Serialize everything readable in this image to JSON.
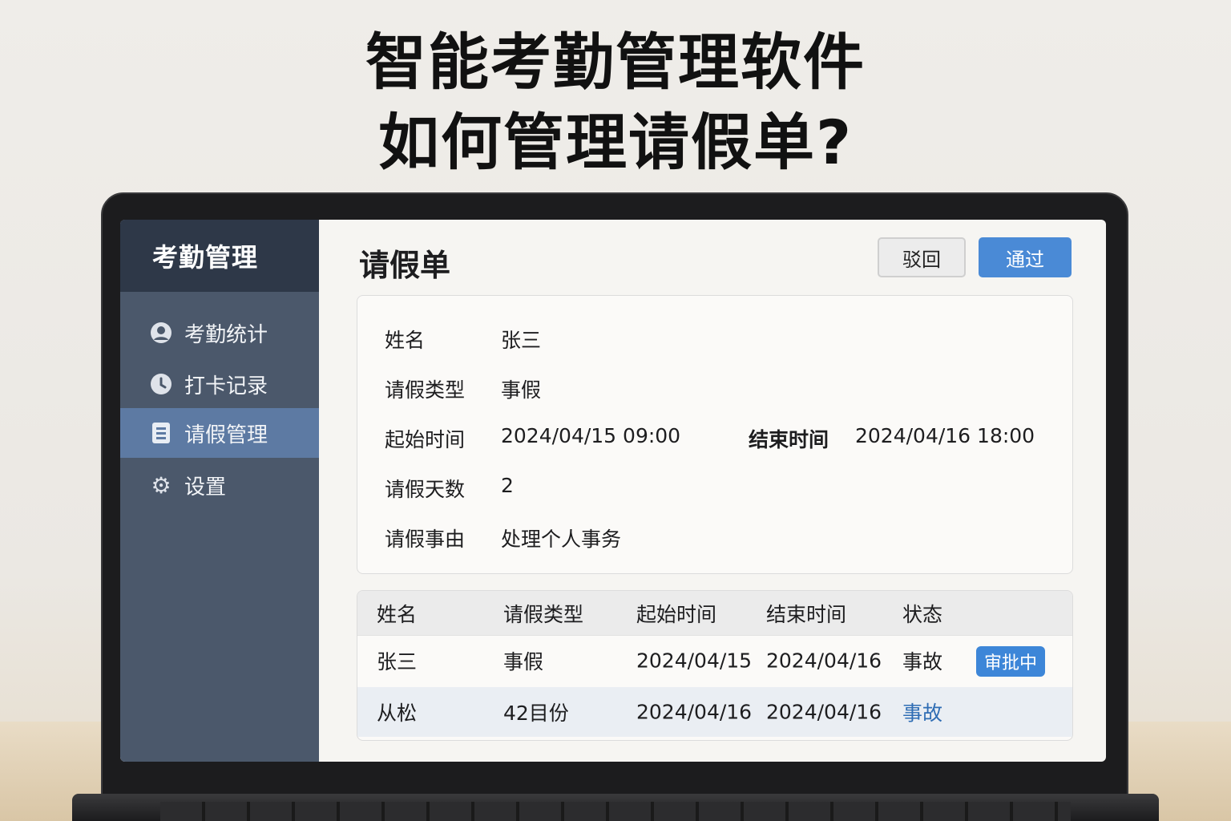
{
  "headline": {
    "line1": "智能考勤管理软件",
    "line2": "如何管理请假单?"
  },
  "sidebar": {
    "title": "考勤管理",
    "items": [
      {
        "label": "考勤统计",
        "icon": "user-icon"
      },
      {
        "label": "打卡记录",
        "icon": "clock-icon"
      },
      {
        "label": "请假管理",
        "icon": "document-icon",
        "active": true
      },
      {
        "label": "设置",
        "icon": "gear-icon"
      }
    ]
  },
  "main": {
    "title": "请假单",
    "reject_label": "驳回",
    "approve_label": "通过",
    "form": {
      "name_label": "姓名",
      "name_value": "张三",
      "type_label": "请假类型",
      "type_value": "事假",
      "start_label": "起始时间",
      "start_value": "2024/04/15 09:00",
      "end_label": "结束时间",
      "end_value": "2024/04/16 18:00",
      "days_label": "请假天数",
      "days_value": "2",
      "reason_label": "请假事由",
      "reason_value": "处理个人事务"
    },
    "table": {
      "headers": [
        "姓名",
        "请假类型",
        "起始时间",
        "结束时间",
        "状态"
      ],
      "rows": [
        [
          "张三",
          "事假",
          "2024/04/15",
          "2024/04/16",
          "事故",
          "审批中"
        ],
        [
          "从松",
          "42目份",
          "2024/04/16",
          "2024/04/16",
          "事故"
        ]
      ]
    }
  },
  "colors": {
    "accent": "#4a8ad6",
    "sidebar": "#4b586b",
    "sidebar_active": "#5d7aa3"
  }
}
